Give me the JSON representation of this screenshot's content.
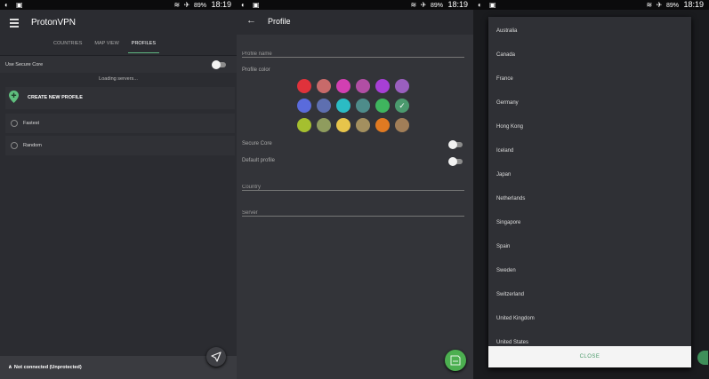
{
  "status_bar": {
    "left_icons": "◐ ▣",
    "battery": "89%",
    "time": "18:19"
  },
  "panel1": {
    "app_title": "ProtonVPN",
    "tabs": [
      "COUNTRIES",
      "MAP VIEW",
      "PROFILES"
    ],
    "active_tab": "PROFILES",
    "secure_core_label": "Use Secure Core",
    "loading_text": "Loading servers...",
    "create_profile_label": "CREATE NEW PROFILE",
    "profiles": [
      "Fastest",
      "Random"
    ],
    "connection_status": "Not connected (Unprotected)",
    "colors": {
      "accent": "#60b883"
    }
  },
  "panel2": {
    "page_title": "Profile",
    "profile_name_placeholder": "Profile name",
    "profile_color_label": "Profile color",
    "color_swatches": [
      "#e0323b",
      "#c86a6a",
      "#d23fb2",
      "#b14ea4",
      "#a73fd6",
      "#9a5fbf",
      "#5a6bdc",
      "#5e6fb0",
      "#2bbcc4",
      "#4e8c8a",
      "#3fb55e",
      "#4b9a6e",
      "#a5bf2f",
      "#8f9c5e",
      "#e7c44b",
      "#a38f5f",
      "#e07a22",
      "#a17e58"
    ],
    "selected_color_index": 11,
    "secure_core_label": "Secure Core",
    "default_profile_label": "Default profile",
    "country_placeholder": "Country",
    "server_placeholder": "Server"
  },
  "panel3": {
    "countries": [
      "Australia",
      "Canada",
      "France",
      "Germany",
      "Hong Kong",
      "Iceland",
      "Japan",
      "Netherlands",
      "Singapore",
      "Spain",
      "Sweden",
      "Switzerland",
      "United Kingdom",
      "United States"
    ],
    "close_label": "CLOSE"
  }
}
